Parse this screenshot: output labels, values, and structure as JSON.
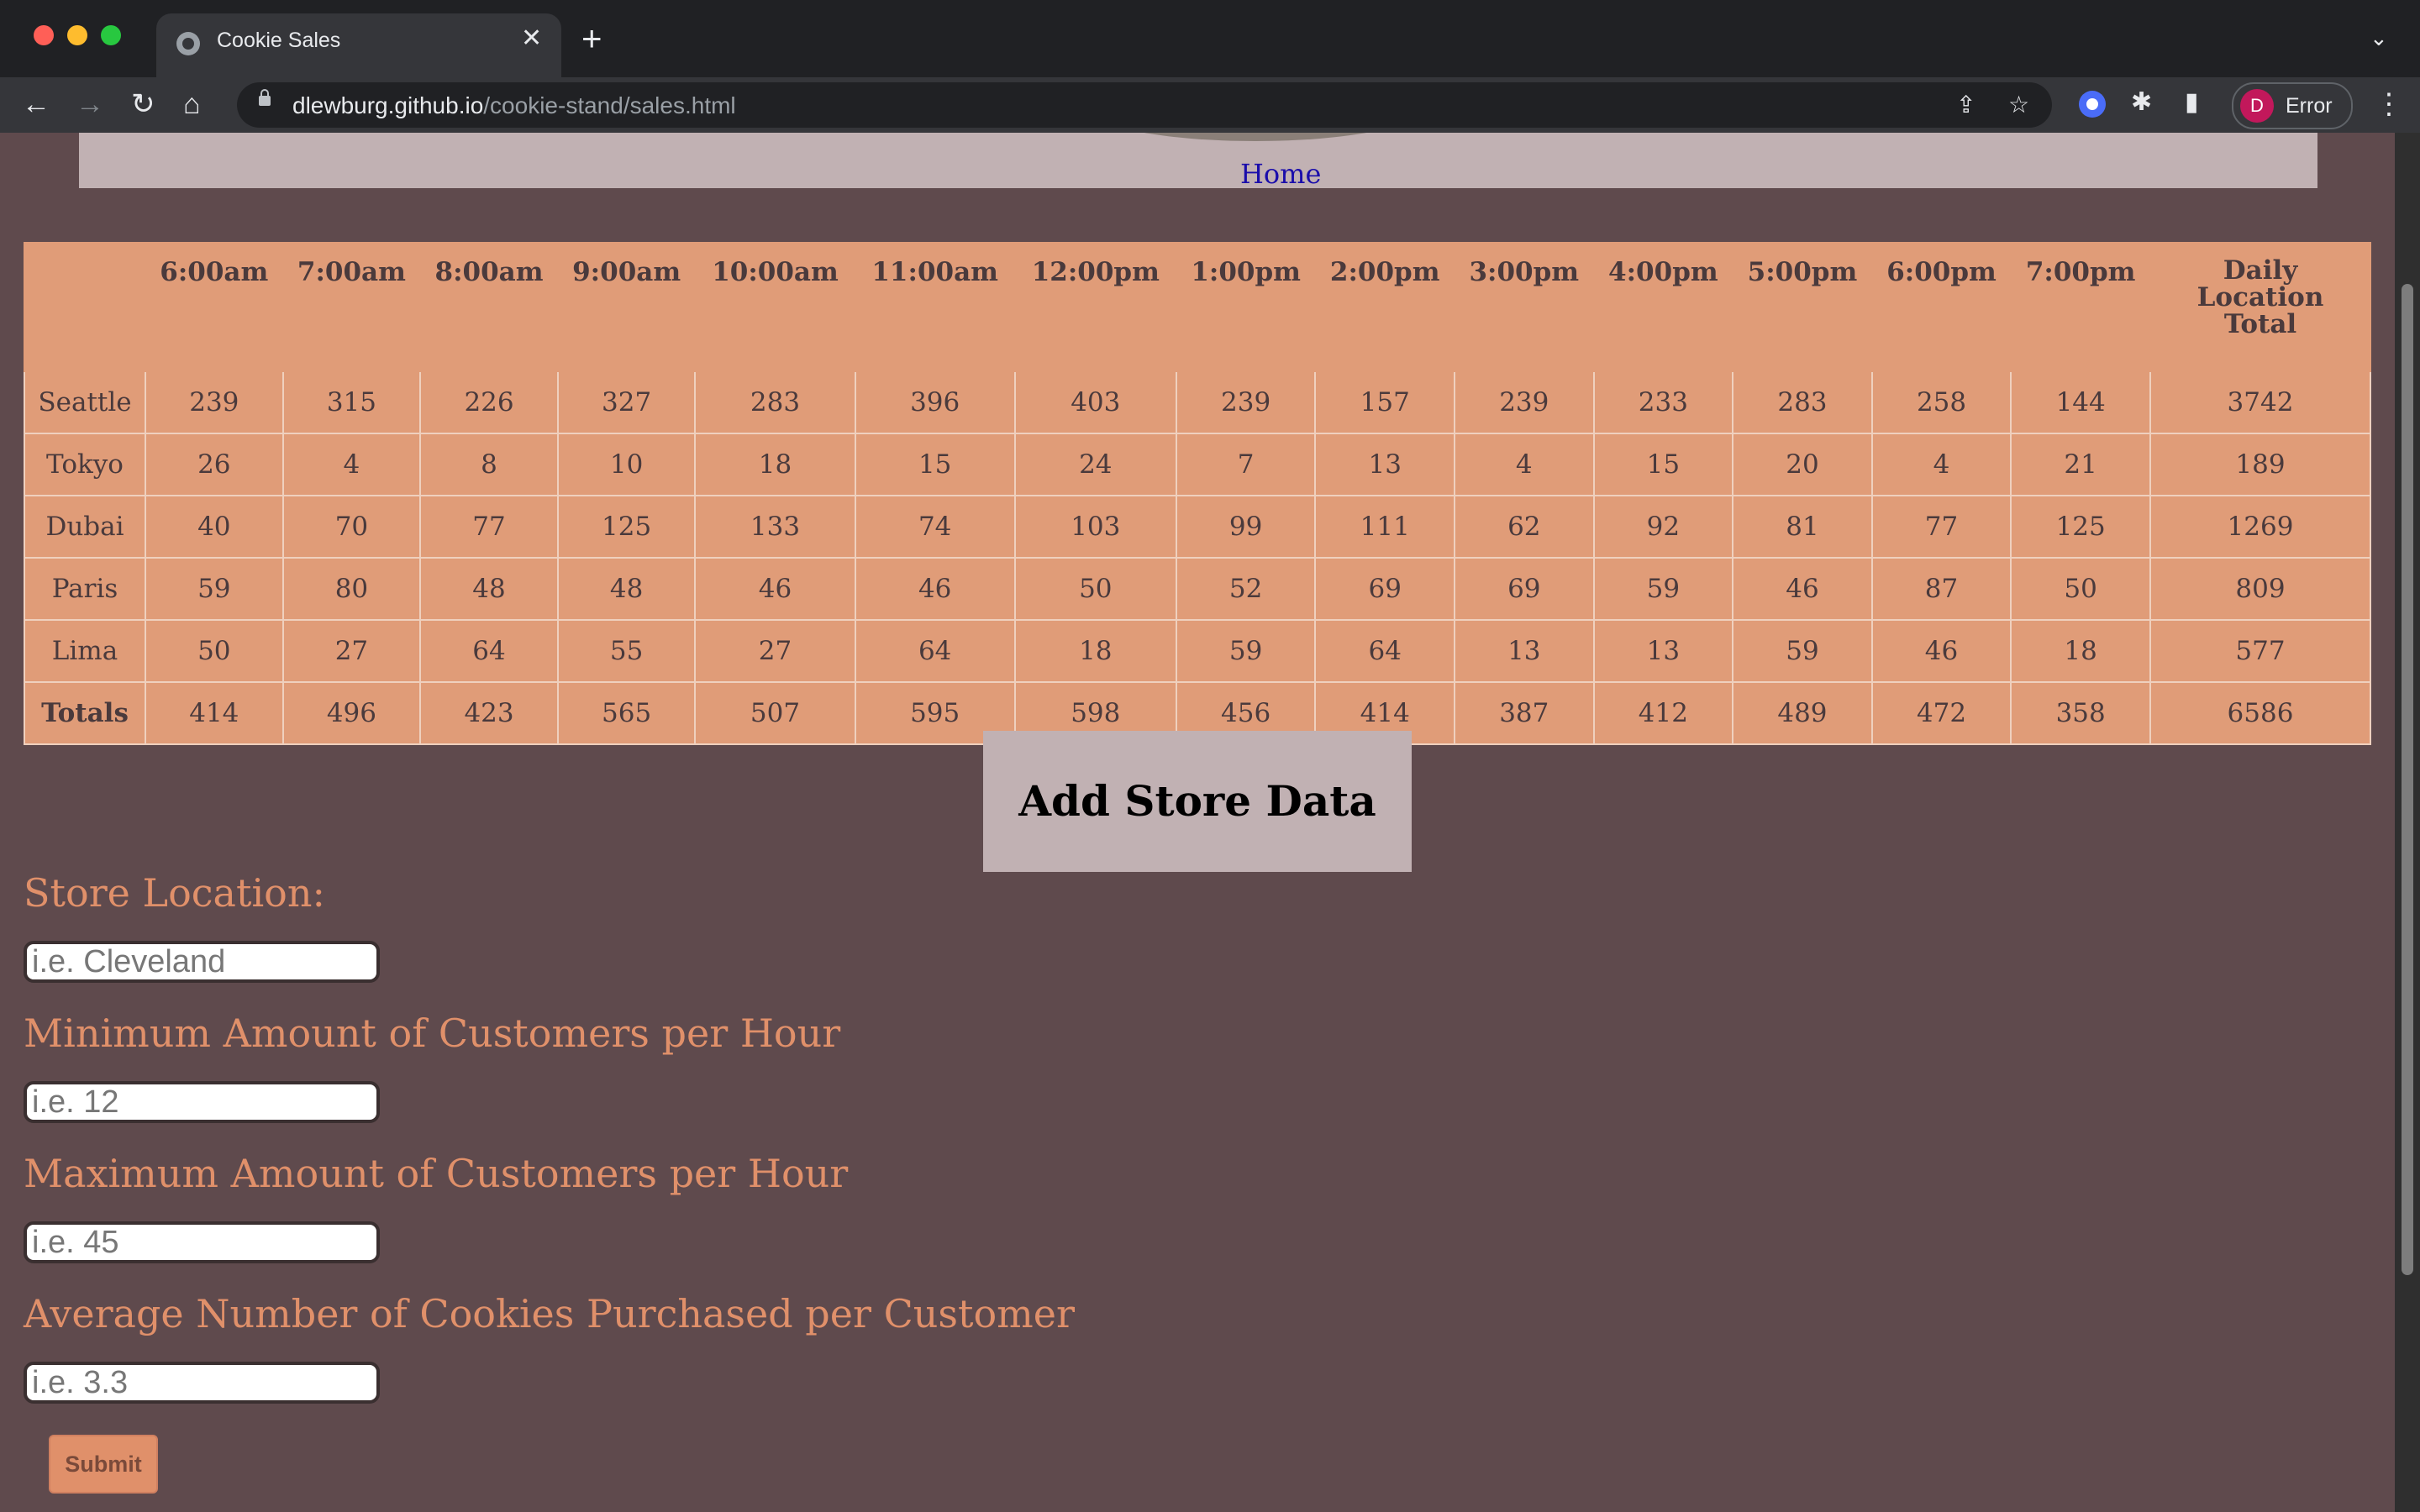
{
  "browser": {
    "tab_title": "Cookie Sales",
    "url_host": "dlewburg.github.io",
    "url_path": "/cookie-stand/sales.html",
    "profile_initial": "D",
    "profile_label": "Error"
  },
  "header": {
    "home_link": "Home"
  },
  "table": {
    "columns": [
      "",
      "6:00am",
      "7:00am",
      "8:00am",
      "9:00am",
      "10:00am",
      "11:00am",
      "12:00pm",
      "1:00pm",
      "2:00pm",
      "3:00pm",
      "4:00pm",
      "5:00pm",
      "6:00pm",
      "7:00pm",
      "Daily Location Total"
    ],
    "rows": [
      [
        "Seattle",
        "239",
        "315",
        "226",
        "327",
        "283",
        "396",
        "403",
        "239",
        "157",
        "239",
        "233",
        "283",
        "258",
        "144",
        "3742"
      ],
      [
        "Tokyo",
        "26",
        "4",
        "8",
        "10",
        "18",
        "15",
        "24",
        "7",
        "13",
        "4",
        "15",
        "20",
        "4",
        "21",
        "189"
      ],
      [
        "Dubai",
        "40",
        "70",
        "77",
        "125",
        "133",
        "74",
        "103",
        "99",
        "111",
        "62",
        "92",
        "81",
        "77",
        "125",
        "1269"
      ],
      [
        "Paris",
        "59",
        "80",
        "48",
        "48",
        "46",
        "46",
        "50",
        "52",
        "69",
        "69",
        "59",
        "46",
        "87",
        "50",
        "809"
      ],
      [
        "Lima",
        "50",
        "27",
        "64",
        "55",
        "27",
        "64",
        "18",
        "59",
        "64",
        "13",
        "13",
        "59",
        "46",
        "18",
        "577"
      ]
    ],
    "totals": [
      "Totals",
      "414",
      "496",
      "423",
      "565",
      "507",
      "595",
      "598",
      "456",
      "414",
      "387",
      "412",
      "489",
      "472",
      "358",
      "6586"
    ]
  },
  "form": {
    "heading": "Add Store Data",
    "fields": [
      {
        "label": "Store Location:",
        "placeholder": "i.e. Cleveland"
      },
      {
        "label": "Minimum Amount of Customers per Hour",
        "placeholder": "i.e. 12"
      },
      {
        "label": "Maximum Amount of Customers per Hour",
        "placeholder": "i.e. 45"
      },
      {
        "label": "Average Number of Cookies Purchased per Customer",
        "placeholder": "i.e. 3.3"
      }
    ],
    "submit_label": "Submit"
  }
}
